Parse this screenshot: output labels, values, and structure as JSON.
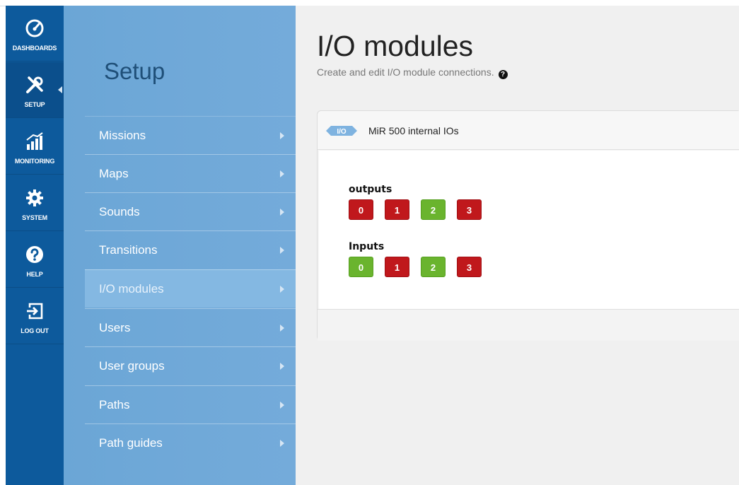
{
  "nav": {
    "items": [
      {
        "label": "DASHBOARDS",
        "icon": "speedometer-icon"
      },
      {
        "label": "SETUP",
        "icon": "tools-icon"
      },
      {
        "label": "MONITORING",
        "icon": "chart-icon"
      },
      {
        "label": "SYSTEM",
        "icon": "gear-icon"
      },
      {
        "label": "HELP",
        "icon": "question-icon"
      },
      {
        "label": "LOG OUT",
        "icon": "logout-icon"
      }
    ],
    "active": "SETUP"
  },
  "submenu": {
    "title": "Setup",
    "items": [
      {
        "label": "Missions"
      },
      {
        "label": "Maps"
      },
      {
        "label": "Sounds"
      },
      {
        "label": "Transitions"
      },
      {
        "label": "I/O modules"
      },
      {
        "label": "Users"
      },
      {
        "label": "User groups"
      },
      {
        "label": "Paths"
      },
      {
        "label": "Path guides"
      }
    ],
    "active": "I/O modules"
  },
  "main": {
    "title": "I/O modules",
    "subtitle": "Create and edit I/O module connections.",
    "card": {
      "badge": "I/O",
      "title": "MiR 500 internal IOs",
      "outputs_label": "outputs",
      "inputs_label": "Inputs",
      "outputs": [
        {
          "label": "0",
          "state": "off"
        },
        {
          "label": "1",
          "state": "off"
        },
        {
          "label": "2",
          "state": "on"
        },
        {
          "label": "3",
          "state": "off"
        }
      ],
      "inputs": [
        {
          "label": "0",
          "state": "on"
        },
        {
          "label": "1",
          "state": "off"
        },
        {
          "label": "2",
          "state": "on"
        },
        {
          "label": "3",
          "state": "off"
        }
      ]
    }
  },
  "colors": {
    "nav_bg": "#0d5a9c",
    "submenu_bg": "#6ba6d6",
    "on": "#6ab42e",
    "off": "#c0181c"
  }
}
